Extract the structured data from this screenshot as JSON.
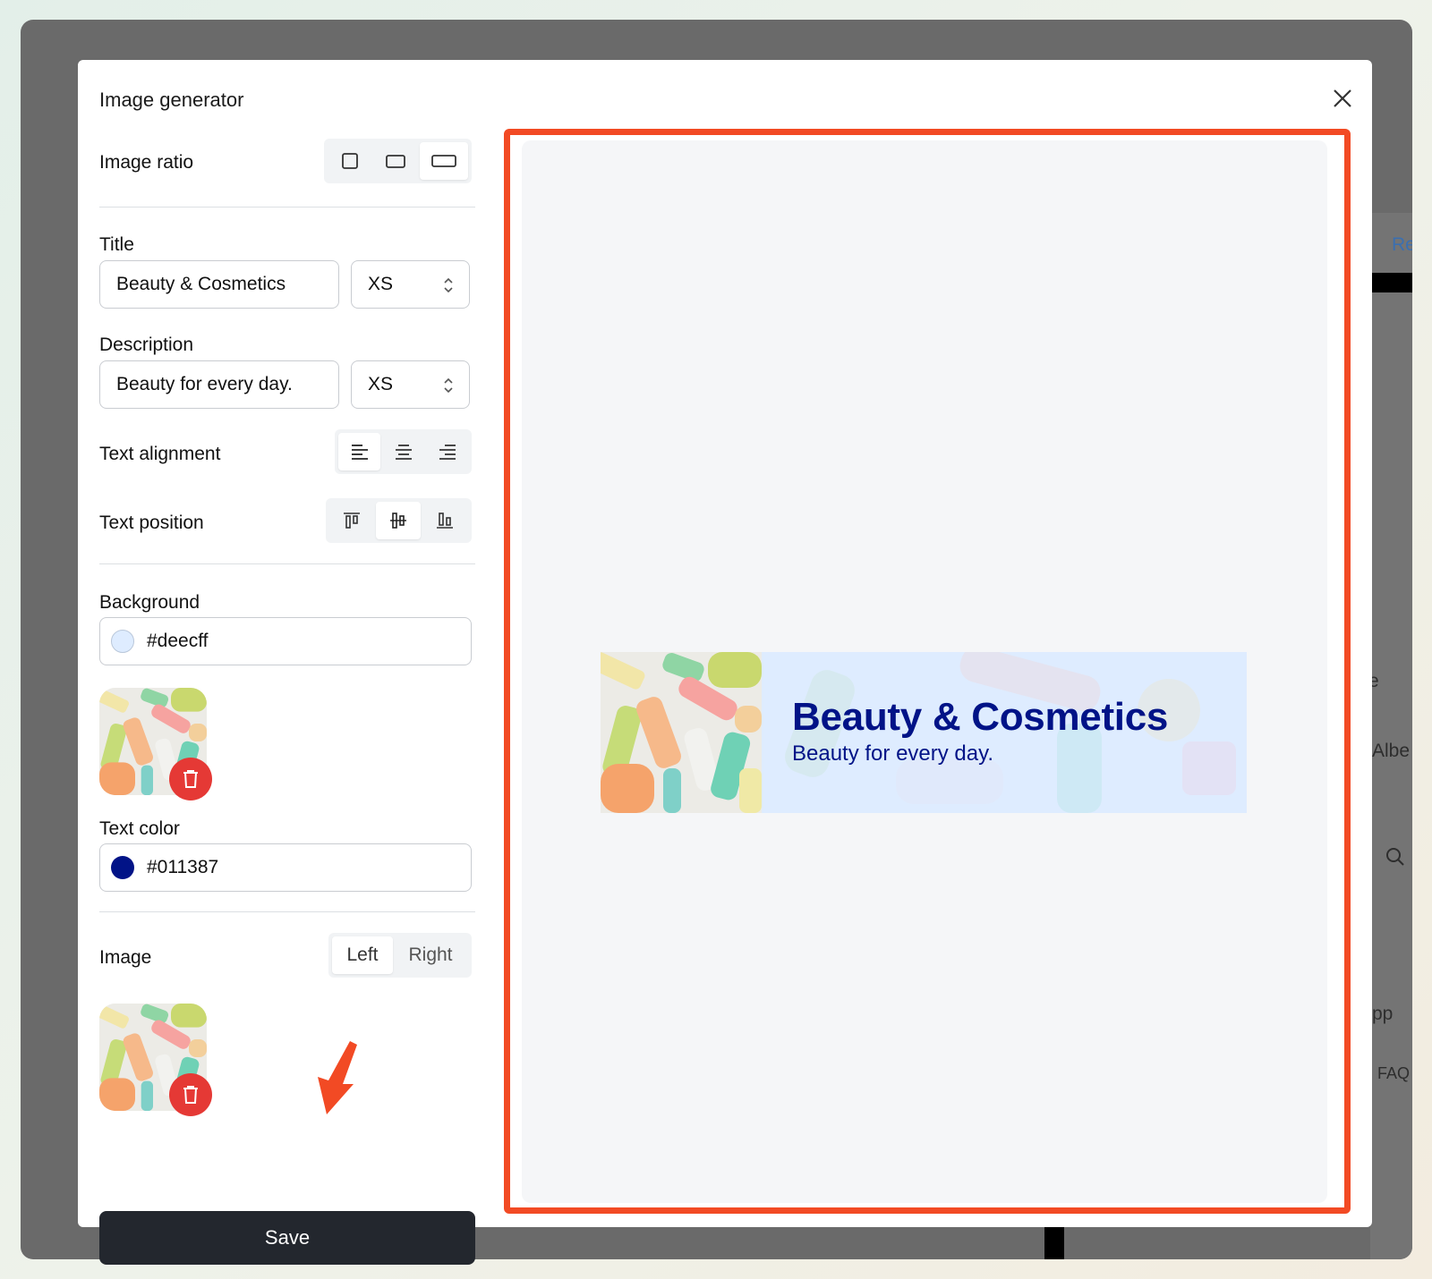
{
  "modal": {
    "title": "Image generator"
  },
  "image_ratio": {
    "label": "Image ratio",
    "options": [
      "square",
      "landscape",
      "wide"
    ],
    "selected": "wide"
  },
  "title_field": {
    "label": "Title",
    "value": "Beauty & Cosmetics",
    "size": "XS"
  },
  "description_field": {
    "label": "Description",
    "value": "Beauty for every day.",
    "size": "XS"
  },
  "text_alignment": {
    "label": "Text alignment",
    "options": [
      "left",
      "center",
      "right"
    ],
    "selected": "left"
  },
  "text_position": {
    "label": "Text position",
    "options": [
      "top",
      "middle",
      "bottom"
    ],
    "selected": "middle"
  },
  "background": {
    "label": "Background",
    "color": "#deecff"
  },
  "text_color": {
    "label": "Text color",
    "color": "#011387"
  },
  "image": {
    "label": "Image",
    "left_label": "Left",
    "right_label": "Right",
    "selected": "Left"
  },
  "save_label": "Save",
  "preview": {
    "title": "Beauty & Cosmetics",
    "description": "Beauty for every day.",
    "background": "#deecff",
    "text_color": "#011387"
  },
  "background_app": {
    "texts": [
      "Re",
      "e",
      "Albe",
      "pp",
      "FAQ"
    ]
  },
  "colors": {
    "accent_red": "#e53935",
    "annotation": "#f24a24",
    "button_dark": "#23272e"
  }
}
